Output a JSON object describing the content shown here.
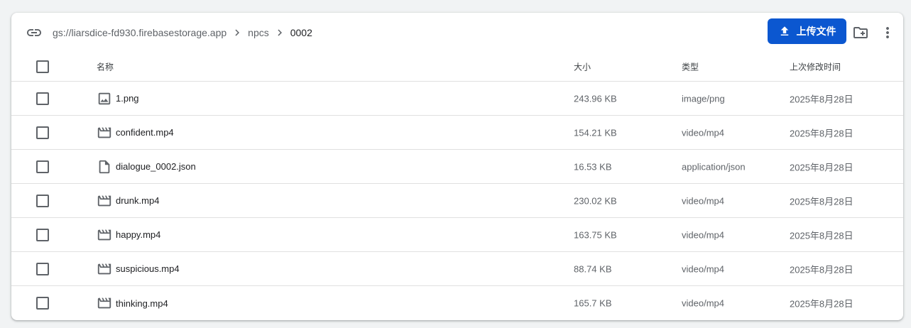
{
  "breadcrumb": {
    "bucket": "gs://liarsdice-fd930.firebasestorage.app",
    "folder": "npcs",
    "current": "0002"
  },
  "toolbar": {
    "upload_label": "上传文件"
  },
  "table": {
    "headers": {
      "name": "名称",
      "size": "大小",
      "type": "类型",
      "modified": "上次修改时间"
    },
    "rows": [
      {
        "icon": "image-icon",
        "name": "1.png",
        "size": "243.96 KB",
        "type": "image/png",
        "modified": "2025年8月28日"
      },
      {
        "icon": "video-icon",
        "name": "confident.mp4",
        "size": "154.21 KB",
        "type": "video/mp4",
        "modified": "2025年8月28日"
      },
      {
        "icon": "document-icon",
        "name": "dialogue_0002.json",
        "size": "16.53 KB",
        "type": "application/json",
        "modified": "2025年8月28日"
      },
      {
        "icon": "video-icon",
        "name": "drunk.mp4",
        "size": "230.02 KB",
        "type": "video/mp4",
        "modified": "2025年8月28日"
      },
      {
        "icon": "video-icon",
        "name": "happy.mp4",
        "size": "163.75 KB",
        "type": "video/mp4",
        "modified": "2025年8月28日"
      },
      {
        "icon": "video-icon",
        "name": "suspicious.mp4",
        "size": "88.74 KB",
        "type": "video/mp4",
        "modified": "2025年8月28日"
      },
      {
        "icon": "video-icon",
        "name": "thinking.mp4",
        "size": "165.7 KB",
        "type": "video/mp4",
        "modified": "2025年8月28日"
      }
    ]
  },
  "colors": {
    "accent": "#0b57d0",
    "icon": "#5f6368"
  }
}
